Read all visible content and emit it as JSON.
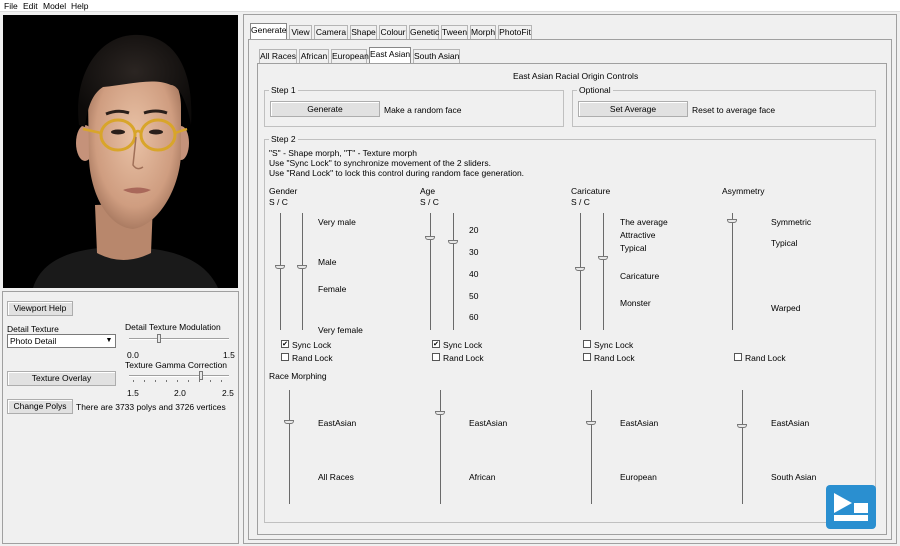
{
  "menu": [
    "File",
    "Edit",
    "Model",
    "Help"
  ],
  "left": {
    "viewport_help": "Viewport Help",
    "detail_texture_label": "Detail Texture",
    "detail_texture_value": "Photo Detail",
    "modulation_label": "Detail Texture Modulation",
    "modulation_min": "0.0",
    "modulation_max": "1.5",
    "texture_overlay": "Texture Overlay",
    "gamma_label": "Texture Gamma Correction",
    "gamma_ticks": [
      "1.5",
      "2.0",
      "2.5"
    ],
    "change_polys": "Change Polys",
    "poly_info": "There are 3733 polys and 3726 vertices"
  },
  "tabs": [
    "Generate",
    "View",
    "Camera",
    "Shape",
    "Colour",
    "Genetic",
    "Tween",
    "Morph",
    "PhotoFit"
  ],
  "subtabs": [
    "All Races",
    "African",
    "European",
    "East Asian",
    "South Asian"
  ],
  "panel_title": "East Asian Racial Origin Controls",
  "step1": {
    "title": "Step 1",
    "button": "Generate",
    "text": "Make a random face"
  },
  "optional": {
    "title": "Optional",
    "button": "Set Average",
    "text": "Reset to average face"
  },
  "step2": {
    "title": "Step 2",
    "help1": "\"S\" - Shape morph, \"T\" - Texture morph",
    "help2": "Use \"Sync Lock\" to synchronize movement of the 2 sliders.",
    "help3": "Use \"Rand Lock\" to lock this control during random face generation."
  },
  "controls": {
    "gender": {
      "title": "Gender",
      "sub": "S / C",
      "labels": [
        "Very male",
        "Male",
        "Female",
        "Very female"
      ]
    },
    "age": {
      "title": "Age",
      "sub": "S / C",
      "labels": [
        "20",
        "30",
        "40",
        "50",
        "60"
      ]
    },
    "caricature": {
      "title": "Caricature",
      "sub": "S / C",
      "labels": [
        "The average",
        "Attractive",
        "Typical",
        "Caricature",
        "Monster"
      ]
    },
    "asymmetry": {
      "title": "Asymmetry",
      "labels": [
        "Symmetric",
        "Typical",
        "Warped"
      ]
    }
  },
  "sync_lock": "Sync Lock",
  "rand_lock": "Rand Lock",
  "race_morphing": {
    "title": "Race Morphing",
    "sliders": [
      {
        "top": "EastAsian",
        "bottom": "All Races"
      },
      {
        "top": "EastAsian",
        "bottom": "African"
      },
      {
        "top": "EastAsian",
        "bottom": "European"
      },
      {
        "top": "EastAsian",
        "bottom": "South Asian"
      }
    ]
  },
  "colors": {
    "accent": "#2a8fd0",
    "viewport_bg": "#000000"
  }
}
